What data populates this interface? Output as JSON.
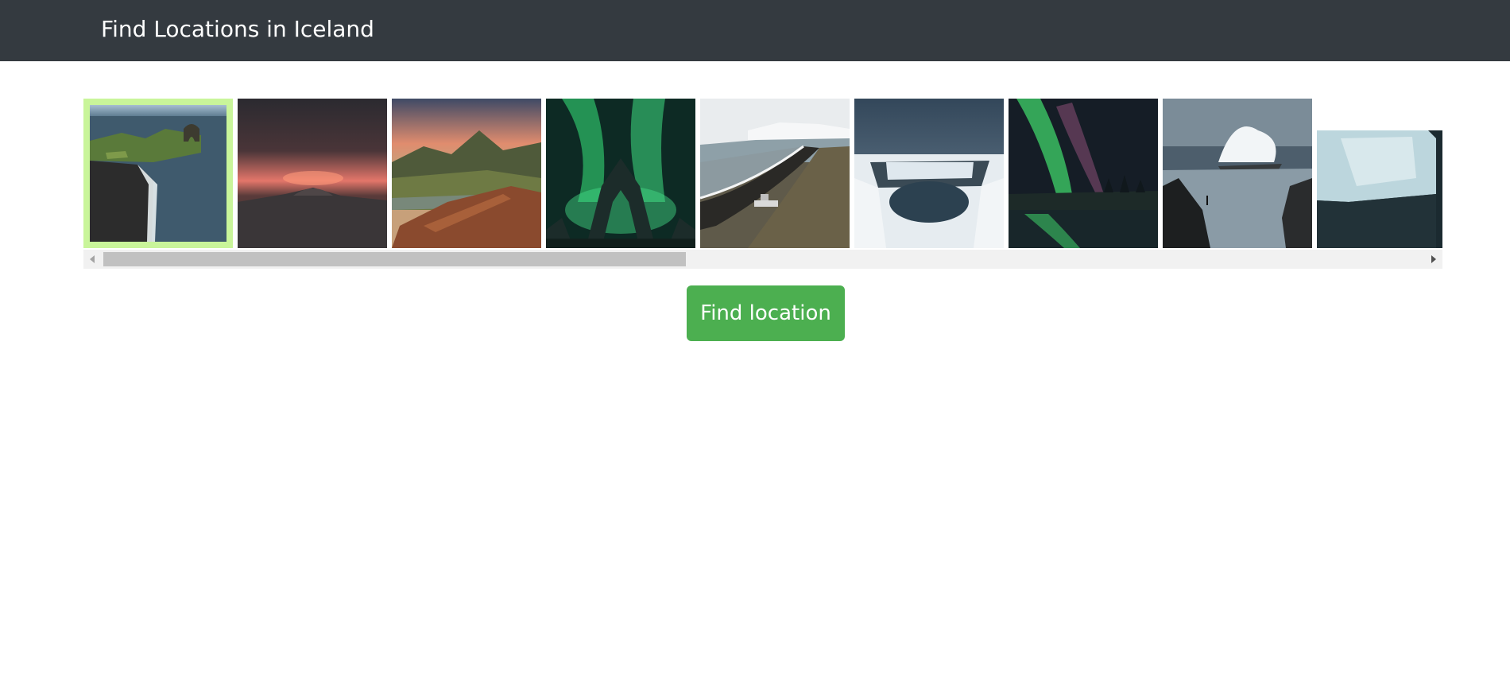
{
  "navbar": {
    "title": "Find Locations in Iceland"
  },
  "gallery": {
    "selected_index": 0,
    "colors": {
      "selected_border": "#c9f59a",
      "scrollbar_track": "#f1f1f1",
      "scrollbar_thumb": "#c1c1c1"
    },
    "thumbnails": [
      {
        "icon": "sea-arch-cliff-photo"
      },
      {
        "icon": "sunset-lava-field-photo"
      },
      {
        "icon": "highland-mountains-photo"
      },
      {
        "icon": "aurora-arch-monument-photo"
      },
      {
        "icon": "black-sand-beach-shipwreck-photo"
      },
      {
        "icon": "frozen-waterfall-photo"
      },
      {
        "icon": "aurora-over-lake-photo"
      },
      {
        "icon": "crashing-waves-rock-photo"
      },
      {
        "icon": "glacier-ice-photo"
      }
    ]
  },
  "actions": {
    "find_label": "Find location",
    "button_color": "#4caf50"
  },
  "header_color": "#343a40"
}
